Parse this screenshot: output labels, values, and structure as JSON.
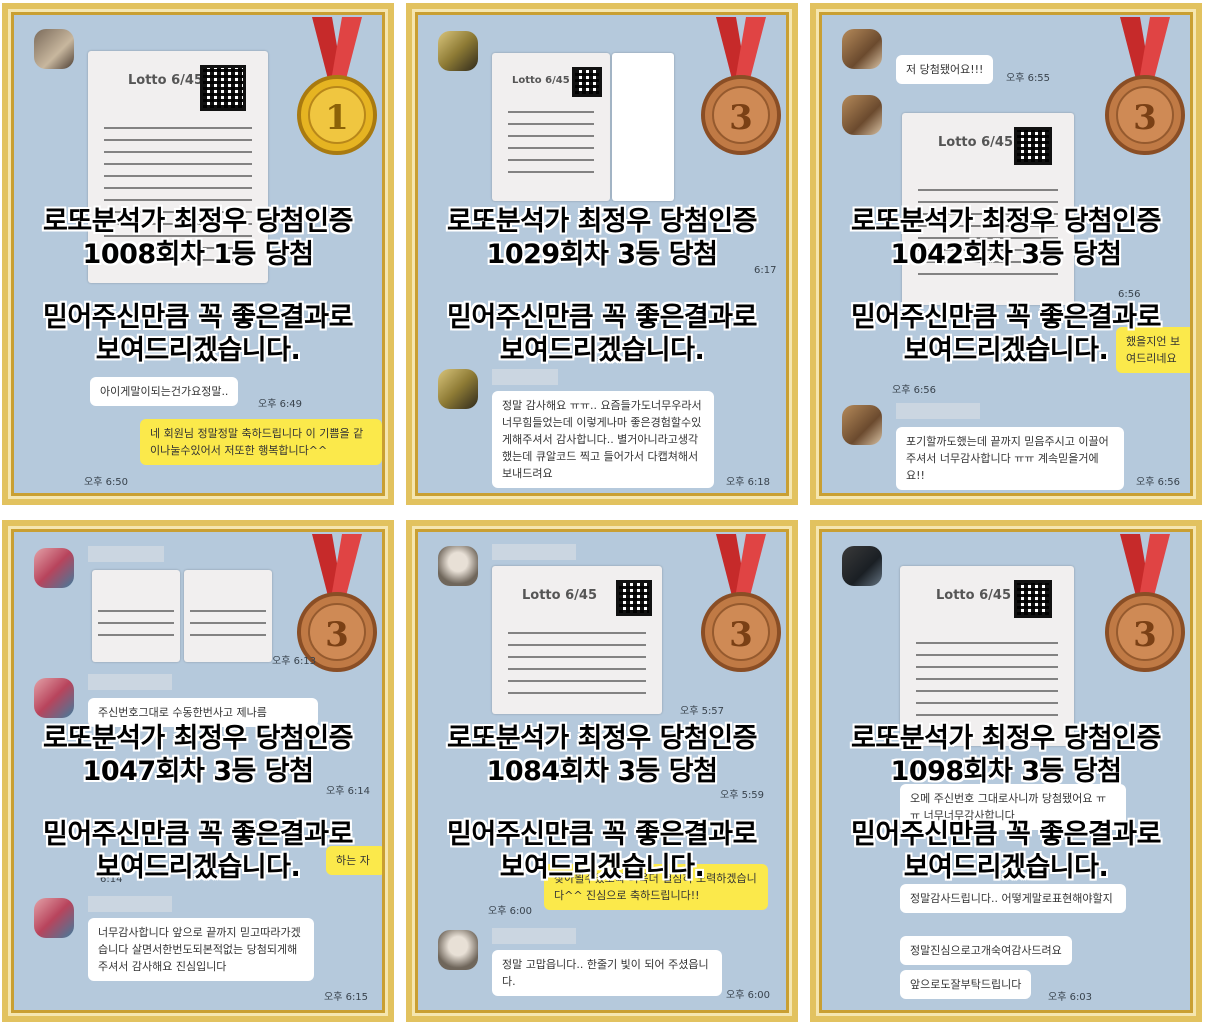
{
  "captions": {
    "headline": "로또분석가 최정우 당첨인증",
    "promise_line1": "믿어주신만큼 꼭 좋은결과로",
    "promise_line2": "보여드리겠습니다."
  },
  "panels": [
    {
      "round_rank": "1008회차 1등 당첨",
      "medal": "1",
      "medal_color": "#e6b422",
      "messages": [
        {
          "text": "아이게말이되는건가요정말..",
          "time": "오후 6:49"
        },
        {
          "text": "네 회원님 정말정말 축하드립니다 이 기쁨을 같이나눌수있어서 저또한 행복합니다^^",
          "time": "오후 6:50"
        }
      ]
    },
    {
      "round_rank": "1029회차 3등 당첨",
      "medal": "3",
      "medal_color": "#c07a45",
      "messages": [
        {
          "text": "6:17",
          "time": ""
        },
        {
          "text": "정말 감사해요 ㅠㅠ.. 요즘들가도너무우라서 너무힘들었는데 이렇게나마 좋은경험할수있게해주셔서 감사합니다.. 별거아니라고생각했는데 큐알코드 찍고 들어가서 다캡쳐해서보내드려요",
          "time": "오후 6:18"
        }
      ]
    },
    {
      "round_rank": "1042회차 3등 당첨",
      "medal": "3",
      "medal_color": "#c07a45",
      "messages": [
        {
          "text": "저 당첨됐어요!!!",
          "time": "오후 6:55"
        },
        {
          "text": "6:56",
          "time": ""
        },
        {
          "text": "했을지언 보여드리네요",
          "time": "오후 6:56"
        },
        {
          "text": "포기할까도했는데 끝까지 믿음주시고 이끌어주셔서 너무감사합니다 ㅠㅠ 계속믿을거에요!!",
          "time": "오후 6:56"
        }
      ]
    },
    {
      "round_rank": "1047회차 3등 당첨",
      "medal": "3",
      "medal_color": "#c07a45",
      "messages": [
        {
          "text": "오후 6:13",
          "time": ""
        },
        {
          "text": "주신번호그대로 수동한번사고 제나름",
          "time": "오후 6:14"
        },
        {
          "text": "하는 자",
          "time": "6:14"
        },
        {
          "text": "너무감사합니다 앞으로 끝까지 믿고따라가겠습니다 살면서한번도되본적없는 당첨되게해주셔서 감사해요 진심입니다",
          "time": "오후 6:15"
        }
      ]
    },
    {
      "round_rank": "1084회차 3등 당첨",
      "medal": "3",
      "medal_color": "#c07a45",
      "messages": [
        {
          "text": "오후 5:57",
          "time": ""
        },
        {
          "text": "오후 5:59",
          "time": ""
        },
        {
          "text": "찾아뵐수있도록 더욱더 열심히 노력하겠습니다^^ 진심으로 축하드립니다!!",
          "time": "오후 6:00"
        },
        {
          "text": "정말 고맙읍니다.. 한줄기 빛이 되어 주셨읍니다.",
          "time": "오후 6:00"
        }
      ]
    },
    {
      "round_rank": "1098회차 3등 당첨",
      "medal": "3",
      "medal_color": "#c07a45",
      "messages": [
        {
          "text": "오메 주신번호 그대로사니까 당첨됐어요 ㅠㅠ 너무너무감사합니다",
          "time": ""
        },
        {
          "text": "정말감사드립니다.. 어떻게말로표현해야할지",
          "time": ""
        },
        {
          "text": "정말진심으로고개숙여감사드려요",
          "time": ""
        },
        {
          "text": "앞으로도잘부탁드립니다",
          "time": "오후 6:03"
        }
      ]
    }
  ],
  "ticket": {
    "brand": "Lotto 6/45"
  }
}
